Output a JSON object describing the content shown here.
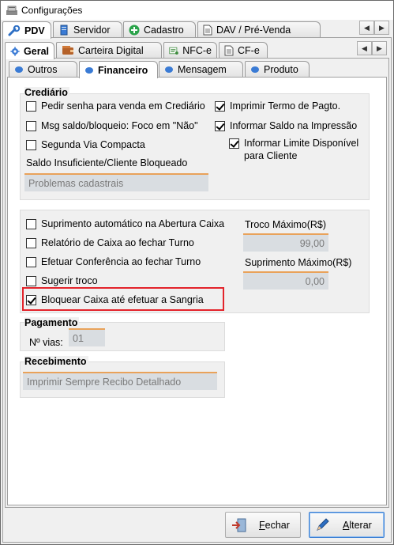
{
  "window": {
    "title": "Configurações"
  },
  "tabs_row1": {
    "pdv": "PDV",
    "servidor": "Servidor",
    "cadastro": "Cadastro",
    "dav": "DAV / Pré-Venda"
  },
  "tabs_row2": {
    "geral": "Geral",
    "carteira": "Carteira Digital",
    "nfce": "NFC-e",
    "cfe": "CF-e"
  },
  "tabs_row3": {
    "outros": "Outros",
    "financeiro": "Financeiro",
    "mensagem": "Mensagem",
    "produto": "Produto"
  },
  "crediario": {
    "title": "Crediário",
    "pedir_senha": "Pedir senha para venda em Crediário",
    "msg_saldo": "Msg saldo/bloqueio: Foco em \"Não\"",
    "segunda_via": "Segunda Via Compacta",
    "imprimir_termo": "Imprimir Termo de Pagto.",
    "informar_saldo": "Informar Saldo na Impressão",
    "informar_limite": "Informar Limite Disponível para Cliente",
    "saldo_label": "Saldo Insuficiente/Cliente Bloqueado",
    "saldo_value": "Problemas cadastrais"
  },
  "caixa": {
    "suprimento_auto": "Suprimento automático na Abertura Caixa",
    "relatorio": "Relatório de Caixa ao fechar Turno",
    "efetuar_conferencia": "Efetuar Conferência ao fechar Turno",
    "sugerir_troco": "Sugerir troco",
    "bloquear_caixa": "Bloquear Caixa até efetuar a Sangria",
    "troco_label": "Troco Máximo(R$)",
    "troco_value": "99,00",
    "suprimento_label": "Suprimento Máximo(R$)",
    "suprimento_value": "0,00"
  },
  "pagamento": {
    "title": "Pagamento",
    "vias_label": "Nº vias:",
    "vias_value": "01"
  },
  "recebimento": {
    "title": "Recebimento",
    "value": "Imprimir Sempre Recibo Detalhado"
  },
  "buttons": {
    "fechar_first": "F",
    "fechar_rest": "echar",
    "alterar_first": "A",
    "alterar_rest": "lterar"
  }
}
